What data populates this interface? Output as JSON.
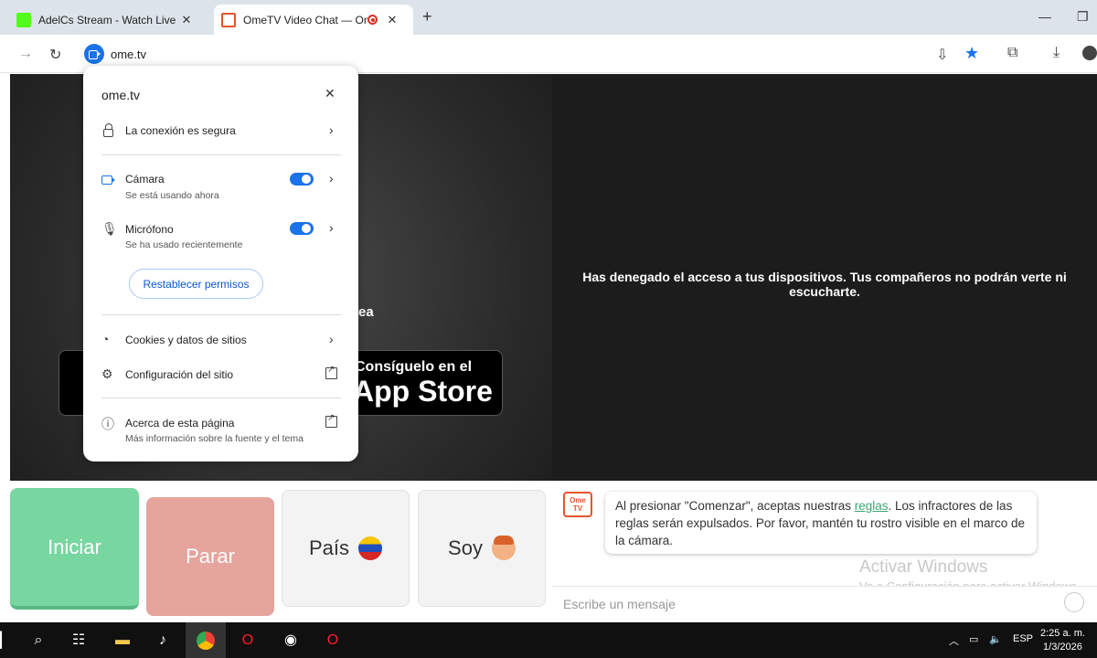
{
  "browser": {
    "tabs": [
      {
        "title": "AdelCs Stream - Watch Live on",
        "favicon_color": "#53fc18"
      },
      {
        "title": "OmeTV Video Chat — Ome",
        "favicon_color": "#e8532b",
        "active": true
      }
    ],
    "url": "ome.tv"
  },
  "popup": {
    "site": "ome.tv",
    "connection": "La conexión es segura",
    "camera": {
      "label": "Cámara",
      "status": "Se está usando ahora",
      "enabled": true
    },
    "microphone": {
      "label": "Micrófono",
      "status": "Se ha usado recientemente",
      "enabled": true
    },
    "reset_label": "Restablecer permisos",
    "cookies": "Cookies y datos de sitios",
    "site_settings": "Configuración del sitio",
    "about": {
      "label": "Acerca de esta página",
      "sub": "Más información sobre la fuente y el tema"
    }
  },
  "page": {
    "denied_message": "Has denegado el acceso a tus dispositivos. Tus compañeros no podrán verte ni escucharte.",
    "partial_text": "ea",
    "appstore_small": "Consíguelo en el",
    "appstore_big": "App Store"
  },
  "controls": {
    "start": "Iniciar",
    "stop": "Parar",
    "country": "País",
    "gender": "Soy"
  },
  "chat": {
    "logo": "Ome TV",
    "rules_pre": "Al presionar \"Comenzar\", aceptas nuestras ",
    "rules_link": "reglas",
    "rules_post": ". Los infractores de las reglas serán expulsados. Por favor, mantén tu rostro visible en el marco de la cámara.",
    "placeholder": "Escribe un mensaje",
    "watermark_title": "Activar Windows",
    "watermark_sub": "Ve a Configuración para activar Windows."
  },
  "taskbar": {
    "lang": "ESP",
    "time": "2:25 a. m.",
    "date": "1/3/2026"
  },
  "colors": {
    "accent": "#1a73e8",
    "start": "#78d6a0",
    "stop": "#e5a49c",
    "brand": "#e8532b"
  }
}
